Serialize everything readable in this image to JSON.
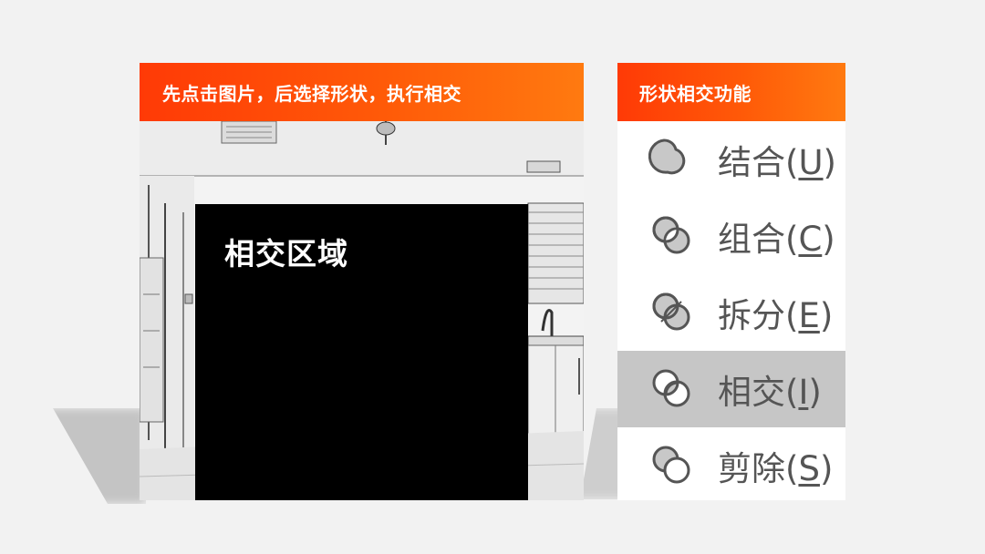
{
  "left_panel": {
    "header": "先点击图片，后选择形状，执行相交",
    "overlay_label": "相交区域"
  },
  "right_panel": {
    "header": "形状相交功能",
    "menu": [
      {
        "text": "结合",
        "key": "U",
        "icon": "union-icon",
        "selected": false
      },
      {
        "text": "组合",
        "key": "C",
        "icon": "combine-icon",
        "selected": false
      },
      {
        "text": "拆分",
        "key": "E",
        "icon": "fragment-icon",
        "selected": false
      },
      {
        "text": "相交",
        "key": "I",
        "icon": "intersect-icon",
        "selected": true
      },
      {
        "text": "剪除",
        "key": "S",
        "icon": "subtract-icon",
        "selected": false
      }
    ]
  },
  "colors": {
    "header_start": "#ff3a06",
    "header_end": "#ff7a10",
    "selected_bg": "#c6c6c6",
    "icon_fill": "#c8c8c8",
    "icon_stroke": "#555555"
  }
}
